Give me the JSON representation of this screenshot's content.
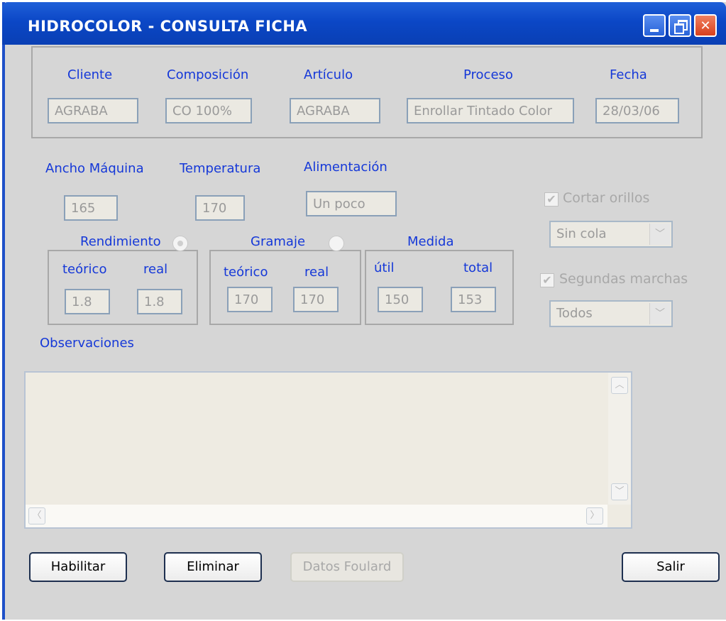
{
  "window": {
    "title": "HIDROCOLOR - CONSULTA FICHA"
  },
  "header_fields": {
    "cliente": {
      "label": "Cliente",
      "value": "AGRABA"
    },
    "composicion": {
      "label": "Composición",
      "value": "CO 100%"
    },
    "articulo": {
      "label": "Artículo",
      "value": "AGRABA"
    },
    "proceso": {
      "label": "Proceso",
      "value": "Enrollar Tintado Color"
    },
    "fecha": {
      "label": "Fecha",
      "value": "28/03/06"
    }
  },
  "machine": {
    "ancho": {
      "label": "Ancho Máquina",
      "value": "165"
    },
    "temperatura": {
      "label": "Temperatura",
      "value": "170"
    },
    "alimentacion": {
      "label": "Alimentación",
      "value": "Un poco"
    }
  },
  "rendimiento": {
    "label": "Rendimiento",
    "teorico_label": "teórico",
    "real_label": "real",
    "teorico": "1.8",
    "real": "1.8"
  },
  "gramaje": {
    "label": "Gramaje",
    "teorico_label": "teórico",
    "real_label": "real",
    "teorico": "170",
    "real": "170"
  },
  "medida": {
    "label": "Medida",
    "util_label": "útil",
    "total_label": "total",
    "util": "150",
    "total": "153"
  },
  "options": {
    "cortar_orillos": {
      "label": "Cortar orillos",
      "checked": true
    },
    "cola_select": "Sin cola",
    "segundas_marchas": {
      "label": "Segundas marchas",
      "checked": true
    },
    "marchas_select": "Todos"
  },
  "observaciones": {
    "label": "Observaciones",
    "value": ""
  },
  "buttons": {
    "habilitar": "Habilitar",
    "eliminar": "Eliminar",
    "datos_foulard": "Datos Foulard",
    "salir": "Salir"
  }
}
